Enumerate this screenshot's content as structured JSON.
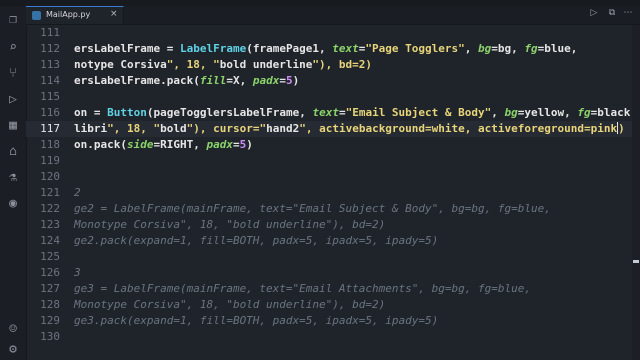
{
  "tab": {
    "label": "MailApp.py",
    "close": "×"
  },
  "toolbar": {
    "run": "▷",
    "split": "⧉",
    "more": "⋯"
  },
  "activity_icons": [
    "files-icon",
    "search-icon",
    "source-control-icon",
    "run-debug-icon",
    "extensions-icon",
    "remote-icon",
    "testing-icon",
    "python-icon",
    "account-icon",
    "settings-icon"
  ],
  "current_line": 117,
  "lines": [
    {
      "n": 111,
      "code": ""
    },
    {
      "n": 112,
      "code": "ersLabelFrame = LabelFrame(framePage1, text=\"Page Togglers\", bg=bg, fg=blue,"
    },
    {
      "n": 113,
      "code": "notype Corsiva\", 18, \"bold underline\"), bd=2)"
    },
    {
      "n": 114,
      "code": "ersLabelFrame.pack(fill=X, padx=5)"
    },
    {
      "n": 115,
      "code": ""
    },
    {
      "n": 116,
      "code": "on = Button(pageTogglersLabelFrame, text=\"Email Subject & Body\", bg=yellow, fg=black,"
    },
    {
      "n": 117,
      "code": "libri\", 18, \"bold\"), cursor=\"hand2\", activebackground=white, activeforeground=pink)"
    },
    {
      "n": 118,
      "code": "on.pack(side=RIGHT, padx=5)"
    },
    {
      "n": 119,
      "code": ""
    },
    {
      "n": 120,
      "code": ""
    },
    {
      "n": 121,
      "code": "2",
      "comment": true
    },
    {
      "n": 122,
      "code": "ge2 = LabelFrame(mainFrame, text=\"Email Subject & Body\", bg=bg, fg=blue,",
      "comment": true
    },
    {
      "n": 123,
      "code": "Monotype Corsiva\", 18, \"bold underline\"), bd=2)",
      "comment": true
    },
    {
      "n": 124,
      "code": "ge2.pack(expand=1, fill=BOTH, padx=5, ipadx=5, ipady=5)",
      "comment": true
    },
    {
      "n": 125,
      "code": ""
    },
    {
      "n": 126,
      "code": "3",
      "comment": true
    },
    {
      "n": 127,
      "code": "ge3 = LabelFrame(mainFrame, text=\"Email Attachments\", bg=bg, fg=blue,",
      "comment": true
    },
    {
      "n": 128,
      "code": "Monotype Corsiva\", 18, \"bold underline\"), bd=2)",
      "comment": true
    },
    {
      "n": 129,
      "code": "ge3.pack(expand=1, fill=BOTH, padx=5, ipadx=5, ipady=5)",
      "comment": true
    },
    {
      "n": 130,
      "code": ""
    }
  ]
}
